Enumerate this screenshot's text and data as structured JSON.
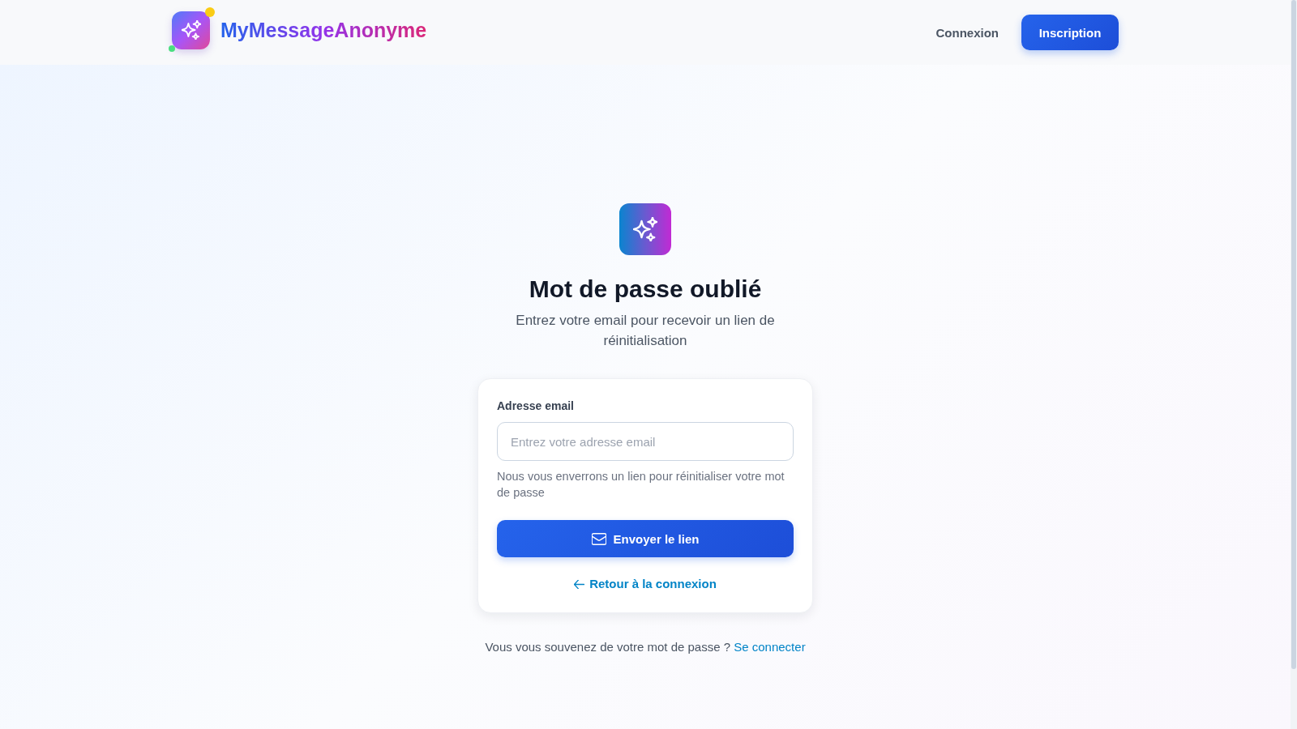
{
  "header": {
    "brand": "MyMessageAnonyme",
    "nav": [
      {
        "label": "Connexion",
        "kind": "link"
      },
      {
        "label": "Inscription",
        "kind": "button"
      }
    ]
  },
  "hero": {
    "title": "Mot de passe oublié",
    "subtitle": "Entrez votre email pour recevoir un lien de réinitialisation"
  },
  "form": {
    "email": {
      "label": "Adresse email",
      "placeholder": "Entrez votre adresse email",
      "hint": "Nous vous enverrons un lien pour réinitialiser votre mot de passe"
    },
    "submit_button": "Envoyer le lien",
    "back_link": "Retour à la connexion"
  },
  "login_prompt": {
    "text": "Vous vous souvenez de votre mot de passe ?",
    "link": "Se connecter"
  }
}
